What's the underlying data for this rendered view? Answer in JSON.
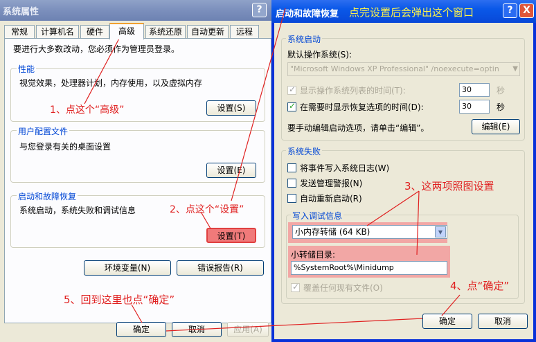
{
  "system_properties": {
    "title": "系统属性",
    "help_button": "?",
    "tabs": [
      "常规",
      "计算机名",
      "硬件",
      "高级",
      "系统还原",
      "自动更新",
      "远程"
    ],
    "admin_note": "要进行大多数改动，您必须作为管理员登录。",
    "performance": {
      "title": "性能",
      "description": "视觉效果，处理器计划，内存使用，以及虚拟内存",
      "settings_button": "设置(S)"
    },
    "user_profiles": {
      "title": "用户配置文件",
      "description": "与您登录有关的桌面设置",
      "settings_button": "设置(E)"
    },
    "startup_recovery": {
      "title": "启动和故障恢复",
      "description": "系统启动，系统失败和调试信息",
      "settings_button": "设置(T)"
    },
    "env_vars_button": "环境变量(N)",
    "error_report_button": "错误报告(R)",
    "ok_button": "确定",
    "cancel_button": "取消",
    "apply_button": "应用(A)"
  },
  "startup_dialog": {
    "title": "启动和故障恢复",
    "help_button": "?",
    "close_button": "X",
    "system_startup": {
      "title": "系统启动",
      "default_os_label": "默认操作系统(S):",
      "default_os_value": "\"Microsoft Windows XP Professional\" /noexecute=optin",
      "show_os_list_label": "显示操作系统列表的时间(T):",
      "show_os_list_checked": true,
      "show_os_list_value": "30",
      "show_recovery_label": "在需要时显示恢复选项的时间(D):",
      "show_recovery_checked": true,
      "show_recovery_value": "30",
      "seconds_unit": "秒",
      "edit_note": "要手动编辑启动选项，请单击“编辑”。",
      "edit_button": "编辑(E)"
    },
    "system_failure": {
      "title": "系统失败",
      "write_event_label": "将事件写入系统日志(W)",
      "write_event_checked": false,
      "send_alert_label": "发送管理警报(N)",
      "send_alert_checked": false,
      "auto_restart_label": "自动重新启动(R)",
      "auto_restart_checked": false,
      "debug_info": {
        "title": "写入调试信息",
        "dump_type": "小内存转储 (64 KB)",
        "dump_dir_label": "小转储目录:",
        "dump_dir_value": "%SystemRoot%\\Minidump",
        "overwrite_label": "覆盖任何现有文件(O)",
        "overwrite_checked": true
      }
    },
    "ok_button": "确定",
    "cancel_button": "取消"
  },
  "annotations": {
    "step1": "1、点这个“高级”",
    "step2": "2、点这个“设置”",
    "step3": "3、这两项照图设置",
    "step4": "4、点“确定”",
    "step5": "5、回到这里也点“确定”",
    "popup_note": "点完设置后会弹出这个窗口"
  },
  "colors": {
    "annotation_red": "#e02020",
    "title_blue": "#0a58e8",
    "group_title_blue": "#0046d5",
    "highlight_pink": "#f2a7a5",
    "popup_note_yellow": "#fff34a"
  }
}
